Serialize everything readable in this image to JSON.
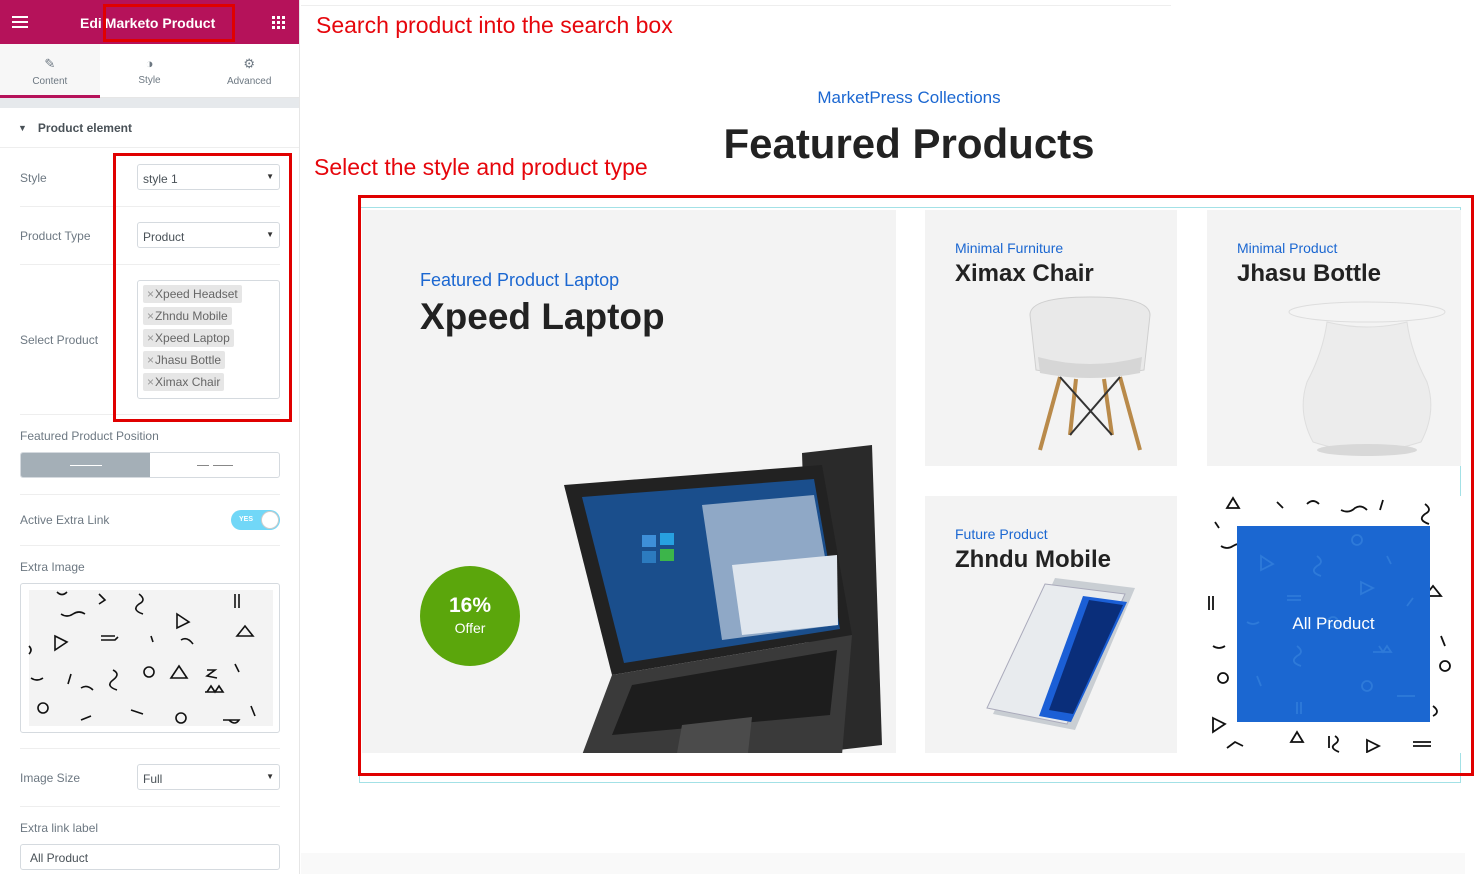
{
  "editor": {
    "title_prefix": "Edi",
    "widget_name": "Marketo Product",
    "tabs": [
      {
        "label": "Content"
      },
      {
        "label": "Style"
      },
      {
        "label": "Advanced"
      }
    ],
    "section_title": "Product element",
    "style_label": "Style",
    "style_value": "style 1",
    "product_type_label": "Product Type",
    "product_type_value": "Product",
    "select_product_label": "Select Product",
    "selected_products": [
      "Xpeed Headset",
      "Zhndu Mobile",
      "Xpeed Laptop",
      "Jhasu Bottle",
      "Ximax Chair"
    ],
    "featured_position_label": "Featured Product Position",
    "active_extra_link_label": "Active Extra Link",
    "active_extra_link_value": "YES",
    "extra_image_label": "Extra Image",
    "image_size_label": "Image Size",
    "image_size_value": "Full",
    "extra_link_label_label": "Extra link label",
    "extra_link_label_value": "All Product"
  },
  "annotations": {
    "search": "Search product into the search box",
    "select": "Select the style and product type"
  },
  "preview": {
    "subtitle": "MarketPress Collections",
    "title": "Featured Products",
    "featured": {
      "category": "Featured Product Laptop",
      "name": "Xpeed Laptop",
      "offer_pct": "16%",
      "offer_label": "Offer"
    },
    "products": [
      {
        "category": "Minimal Furniture",
        "name": "Ximax Chair"
      },
      {
        "category": "Minimal Product",
        "name": "Jhasu Bottle"
      },
      {
        "category": "Future Product",
        "name": "Zhndu Mobile"
      }
    ],
    "all_product_label": "All Product"
  },
  "colors": {
    "brand": "#b5125a",
    "accent_blue": "#1b67d1",
    "annotation_red": "#e00000",
    "offer_green": "#5ba60c"
  }
}
